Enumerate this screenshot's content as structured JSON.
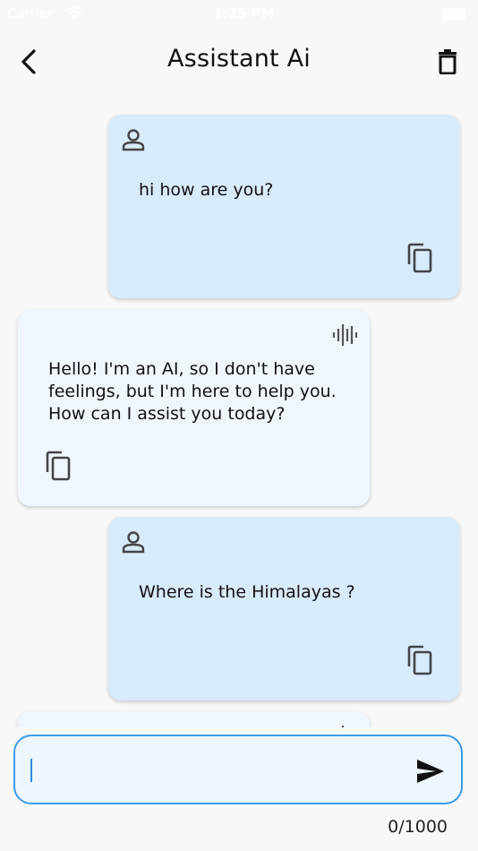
{
  "status": {
    "carrier": "Carrier",
    "time": "1:25 PM"
  },
  "header": {
    "title": "Assistant Ai"
  },
  "messages": [
    {
      "role": "user",
      "text": "hi how are you?"
    },
    {
      "role": "ai",
      "text": "Hello! I'm an AI, so I don't have feelings, but I'm here to help you. How can I assist you today?"
    },
    {
      "role": "user",
      "text": "Where is the Himalayas ?"
    }
  ],
  "input": {
    "value": "",
    "counter": "0/1000"
  },
  "colors": {
    "user_bubble": "#d8ebfb",
    "ai_bubble": "#f0f6fe",
    "accent": "#3d9be9"
  },
  "icons": {
    "back": "chevron-left-icon",
    "delete": "trash-icon",
    "user": "person-icon",
    "voice": "waveform-icon",
    "copy": "copy-icon",
    "send": "send-icon"
  }
}
